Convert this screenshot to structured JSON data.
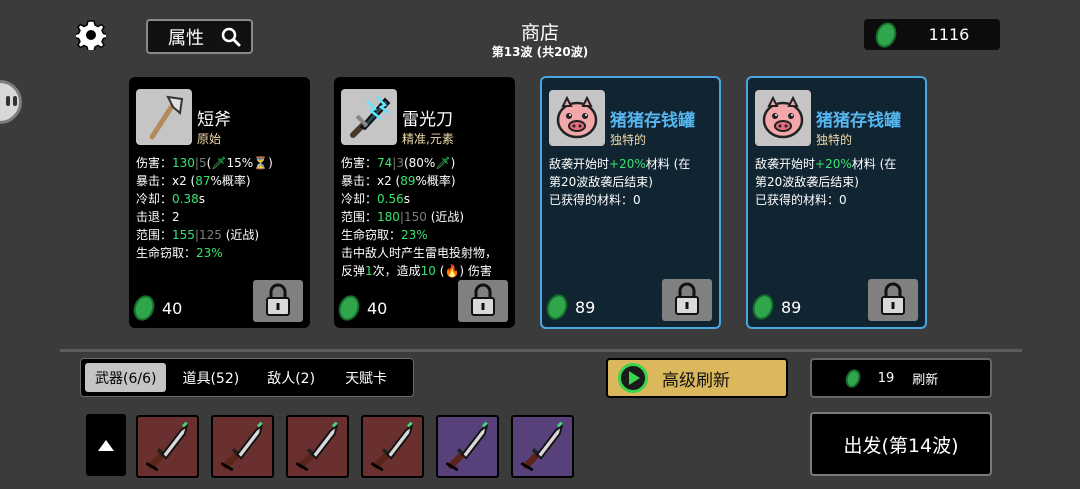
{
  "header": {
    "title": "商店",
    "wave": "第13波 (共20波)",
    "attr_label": "属性",
    "money": "1116"
  },
  "cards": [
    {
      "name": "短斧",
      "subtitle": "原始",
      "price": "40",
      "icon": "axe-icon",
      "stats": [
        [
          {
            "t": "伤害："
          },
          {
            "t": "130",
            "c": "g"
          },
          {
            "t": "|",
            "c": "d"
          },
          {
            "t": "5",
            "c": "d"
          },
          {
            "t": "("
          },
          {
            "t": "🗡",
            "c": "g"
          },
          {
            "t": "15%"
          },
          {
            "t": "⏳",
            "c": "d"
          },
          {
            "t": ")"
          }
        ],
        [
          {
            "t": "暴击：x2 ("
          },
          {
            "t": "87",
            "c": "g"
          },
          {
            "t": "%概率)"
          }
        ],
        [
          {
            "t": "冷却："
          },
          {
            "t": "0.38",
            "c": "g"
          },
          {
            "t": "s"
          }
        ],
        [
          {
            "t": "击退：2"
          }
        ],
        [
          {
            "t": "范围："
          },
          {
            "t": "155",
            "c": "g"
          },
          {
            "t": "|",
            "c": "d"
          },
          {
            "t": "125",
            "c": "d"
          },
          {
            "t": " (近战)"
          }
        ],
        [
          {
            "t": "生命窃取："
          },
          {
            "t": "23%",
            "c": "g"
          }
        ]
      ]
    },
    {
      "name": "雷光刀",
      "subtitle": "精准,元素",
      "price": "40",
      "icon": "lightning-blade-icon",
      "stats": [
        [
          {
            "t": "伤害："
          },
          {
            "t": "74",
            "c": "g"
          },
          {
            "t": "|",
            "c": "d"
          },
          {
            "t": "3",
            "c": "d"
          },
          {
            "t": "(80%"
          },
          {
            "t": "🗡",
            "c": "g"
          },
          {
            "t": ")"
          }
        ],
        [
          {
            "t": "暴击：x2 ("
          },
          {
            "t": "89",
            "c": "g"
          },
          {
            "t": "%概率)"
          }
        ],
        [
          {
            "t": "冷却："
          },
          {
            "t": "0.56",
            "c": "g"
          },
          {
            "t": "s"
          }
        ],
        [
          {
            "t": "范围："
          },
          {
            "t": "180",
            "c": "g"
          },
          {
            "t": "|",
            "c": "d"
          },
          {
            "t": "150",
            "c": "d"
          },
          {
            "t": " (近战)"
          }
        ],
        [
          {
            "t": "生命窃取："
          },
          {
            "t": "23%",
            "c": "g"
          }
        ],
        [
          {
            "t": "击中敌人时产生雷电投射物，"
          }
        ],
        [
          {
            "t": "反弹"
          },
          {
            "t": "1",
            "c": "g"
          },
          {
            "t": "次，造成"
          },
          {
            "t": "10",
            "c": "g"
          },
          {
            "t": " (🔥) 伤害"
          }
        ]
      ]
    },
    {
      "name": "猪猪存钱罐",
      "subtitle": "独特的",
      "price": "89",
      "icon": "piggy-bank-icon",
      "stats": [
        [
          {
            "t": "敌袭开始时"
          },
          {
            "t": "+20%",
            "c": "g"
          },
          {
            "t": "材料 (在"
          }
        ],
        [
          {
            "t": "第20波敌袭后结束)"
          }
        ],
        [
          {
            "t": "已获得的材料：0"
          }
        ]
      ]
    },
    {
      "name": "猪猪存钱罐",
      "subtitle": "独特的",
      "price": "89",
      "icon": "piggy-bank-icon",
      "stats": [
        [
          {
            "t": "敌袭开始时"
          },
          {
            "t": "+20%",
            "c": "g"
          },
          {
            "t": "材料 (在"
          }
        ],
        [
          {
            "t": "第20波敌袭后结束)"
          }
        ],
        [
          {
            "t": "已获得的材料：0"
          }
        ]
      ]
    }
  ],
  "tabs": [
    "武器(6/6)",
    "道具(52)",
    "敌人(2)",
    "天赋卡"
  ],
  "buttons": {
    "advanced_refresh": "高级刷新",
    "refresh_cost": "19",
    "refresh_label": "刷新",
    "go": "出发(第14波)"
  },
  "inventory": [
    {
      "icon": "knife-icon",
      "tier": "red"
    },
    {
      "icon": "knife-icon",
      "tier": "red"
    },
    {
      "icon": "knife-icon",
      "tier": "red"
    },
    {
      "icon": "knife-icon",
      "tier": "red"
    },
    {
      "icon": "knife-icon",
      "tier": "purple"
    },
    {
      "icon": "knife-icon",
      "tier": "purple"
    }
  ],
  "colors": {
    "background": "#3b3b3b",
    "highlight_green": "#38e36f",
    "unique_blue": "#56b6f0",
    "gold": "#dcb85c"
  }
}
